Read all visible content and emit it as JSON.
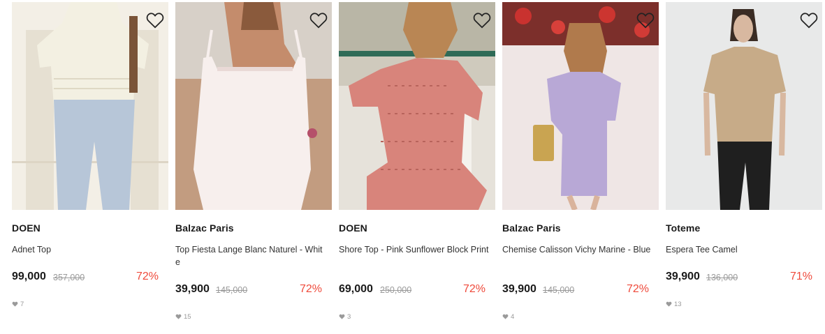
{
  "products": [
    {
      "brand": "DOEN",
      "name": "Adnet Top",
      "price": "99,000",
      "original_price": "357,000",
      "discount": "72%",
      "likes": "7",
      "photo_icon": "blouse-photo",
      "bg": "#ece7dc",
      "garment": "#f2efe3"
    },
    {
      "brand": "Balzac Paris",
      "name": "Top Fiesta Lange Blanc Naturel - White",
      "price": "39,900",
      "original_price": "145,000",
      "discount": "72%",
      "likes": "15",
      "photo_icon": "camisole-photo",
      "bg": "#d9c7b7",
      "garment": "#f6eeec"
    },
    {
      "brand": "DOEN",
      "name": "Shore Top - Pink Sunflower Block Print",
      "price": "69,000",
      "original_price": "250,000",
      "discount": "72%",
      "likes": "3",
      "photo_icon": "print-top-photo",
      "bg": "#c9c7bb",
      "garment": "#d9827a"
    },
    {
      "brand": "Balzac Paris",
      "name": "Chemise Calisson Vichy Marine - Blue",
      "price": "39,900",
      "original_price": "145,000",
      "discount": "72%",
      "likes": "4",
      "photo_icon": "shirt-photo",
      "bg": "#e7dede",
      "garment": "#b6a6d3"
    },
    {
      "brand": "Toteme",
      "name": "Espera Tee Camel",
      "price": "39,900",
      "original_price": "136,000",
      "discount": "71%",
      "likes": "13",
      "photo_icon": "tee-photo",
      "bg": "#e9eaea",
      "garment": "#c7ab88"
    }
  ],
  "colors": {
    "discount": "#ef4a3b",
    "original_price": "#9a9a9a",
    "likes": "#999999"
  }
}
